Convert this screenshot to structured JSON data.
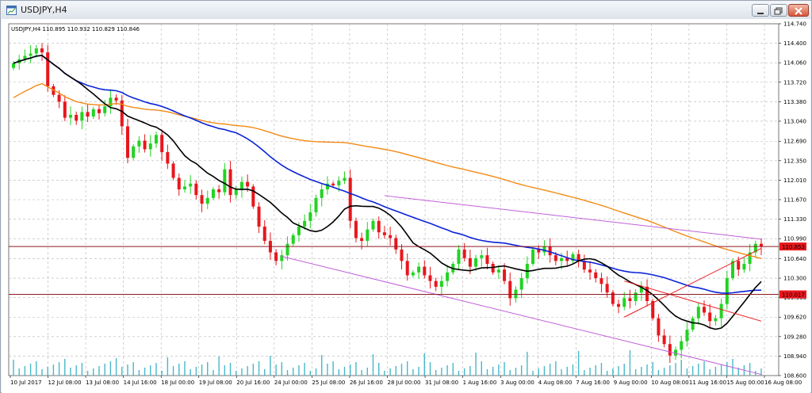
{
  "window": {
    "title": "USDJPY,H4",
    "buttons": [
      "minimize-button",
      "maximize-button",
      "close-button"
    ]
  },
  "chart_data": {
    "type": "candlestick",
    "symbol_info": "USDJPY,H4  110.895 110.932 110.829 110.846",
    "price_axis": {
      "ticks": [
        "114.740",
        "114.400",
        "114.060",
        "113.720",
        "113.380",
        "113.040",
        "112.690",
        "112.350",
        "112.010",
        "111.670",
        "111.330",
        "110.990",
        "110.640",
        "110.300",
        "109.960",
        "109.620",
        "109.280",
        "108.940",
        "108.600"
      ],
      "range": [
        108.6,
        114.74
      ]
    },
    "time_axis": {
      "ticks": [
        "10 Jul 2017",
        "12 Jul 08:00",
        "13 Jul 08:00",
        "14 Jul 16:00",
        "18 Jul 00:00",
        "19 Jul 08:00",
        "20 Jul 16:00",
        "24 Jul 00:00",
        "25 Jul 08:00",
        "26 Jul 16:00",
        "28 Jul 00:00",
        "31 Jul 08:00",
        "1 Aug 16:00",
        "3 Aug 00:00",
        "4 Aug 08:00",
        "7 Aug 16:00",
        "9 Aug 00:00",
        "10 Aug 08:00",
        "11 Aug 16:00",
        "15 Aug 00:00",
        "16 Aug 08:00"
      ]
    },
    "price_labels": [
      {
        "text": "110.853",
        "price": 110.853,
        "color": "#e8161c"
      },
      {
        "text": "110.017",
        "price": 110.017,
        "color": "#e8161c"
      }
    ],
    "colors": {
      "bull": "#22d322",
      "bear": "#e8161c",
      "grid": "#b4b4b4",
      "volume": "#46b8c8",
      "ma_black": "#000000",
      "ma_blue": "#0a22d8",
      "ma_orange": "#f28a14",
      "channel": "#c060d8",
      "hline": "#8e1a20",
      "trendline": "#e8161c"
    },
    "closes": [
      114.05,
      114.12,
      114.18,
      114.22,
      114.31,
      114.24,
      113.65,
      113.5,
      113.38,
      113.1,
      113.15,
      113.05,
      113.2,
      113.12,
      113.25,
      113.18,
      113.3,
      113.45,
      113.4,
      112.95,
      112.4,
      112.6,
      112.7,
      112.55,
      112.65,
      112.8,
      112.5,
      112.3,
      112.05,
      111.85,
      111.9,
      111.95,
      111.75,
      111.6,
      111.7,
      111.85,
      111.8,
      112.2,
      111.75,
      111.85,
      111.98,
      111.9,
      111.55,
      111.2,
      110.95,
      110.75,
      110.6,
      110.7,
      110.9,
      111.05,
      111.2,
      111.3,
      111.45,
      111.7,
      111.85,
      111.95,
      111.92,
      112.0,
      112.05,
      111.3,
      111.0,
      110.95,
      111.15,
      111.3,
      111.1,
      111.05,
      111.0,
      110.8,
      110.6,
      110.35,
      110.4,
      110.5,
      110.35,
      110.25,
      110.15,
      110.25,
      110.4,
      110.55,
      110.8,
      110.65,
      110.5,
      110.65,
      110.7,
      110.55,
      110.4,
      110.45,
      110.25,
      109.95,
      110.1,
      110.3,
      110.55,
      110.8,
      110.75,
      110.85,
      110.7,
      110.6,
      110.65,
      110.6,
      110.72,
      110.6,
      110.45,
      110.4,
      110.3,
      110.2,
      110.05,
      109.85,
      109.8,
      109.95,
      109.9,
      110.05,
      110.15,
      109.9,
      109.6,
      109.3,
      109.15,
      108.95,
      109.05,
      109.2,
      109.4,
      109.6,
      109.8,
      109.7,
      109.55,
      109.6,
      109.85,
      110.3,
      110.6,
      110.45,
      110.55,
      110.75,
      110.9,
      110.85
    ]
  }
}
